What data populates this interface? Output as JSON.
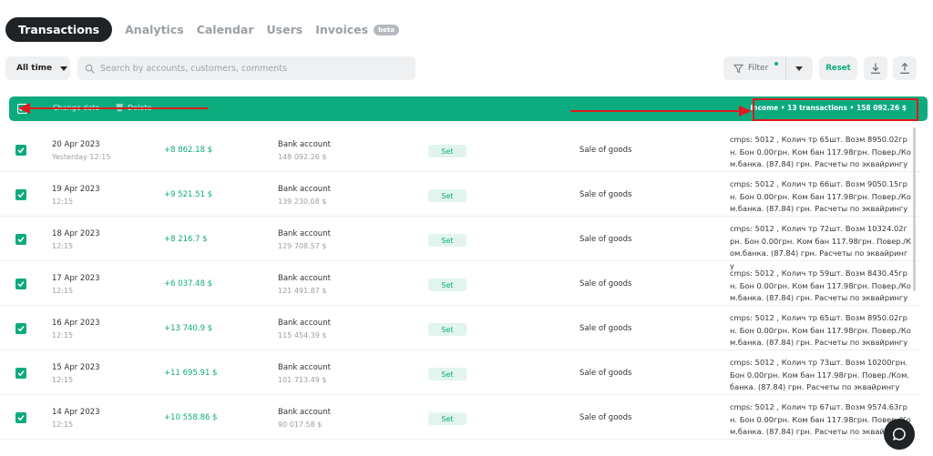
{
  "nav": {
    "tabs": [
      "Transactions",
      "Analytics",
      "Calendar",
      "Users",
      "Invoices"
    ],
    "beta": "beta"
  },
  "toolbar": {
    "period": "All time",
    "search_placeholder": "Search by accounts, customers, comments",
    "filter": "Filter",
    "reset": "Reset"
  },
  "actionbar": {
    "change_date": "Change date",
    "delete": "Delete",
    "income_summary": "Income • 13 transactions • 158 092.26 $"
  },
  "colors": {
    "accent": "#0cab7e",
    "annotation": "#e0191f",
    "dark": "#1f2326"
  },
  "rows": [
    {
      "date": "20 Apr 2023",
      "time": "Yesterday 12:15",
      "amount": "+8 862.18 $",
      "account": "Bank account",
      "balance": "148 092.26 $",
      "set": "Set",
      "category": "Sale of goods",
      "desc": "cmps: 5012 , Колич тр 65шт. Возм 8950.02грн. Бон 0.00грн. Ком бан 117.98грн. Повер./Ком.банка. (87.84) грн. Расчеты по эквайрингу"
    },
    {
      "date": "19 Apr 2023",
      "time": "12:15",
      "amount": "+9 521.51 $",
      "account": "Bank account",
      "balance": "139 230.08 $",
      "set": "Set",
      "category": "Sale of goods",
      "desc": "cmps: 5012 , Колич тр 66шт. Возм 9050.15грн. Бон 0.00грн. Ком бан 117.98грн. Повер./Ком.банка. (87.84) грн. Расчеты по эквайрингу"
    },
    {
      "date": "18 Apr 2023",
      "time": "12:15",
      "amount": "+8 216.7 $",
      "account": "Bank account",
      "balance": "129 708.57 $",
      "set": "Set",
      "category": "Sale of goods",
      "desc": "cmps: 5012 , Колич тр 72шт. Возм 10324.02грн. Бон 0.00грн. Ком бан 117.98грн. Повер./Ком.банка. (87.84) грн. Расчеты по эквайрингу"
    },
    {
      "date": "17 Apr 2023",
      "time": "12:15",
      "amount": "+6 037.48 $",
      "account": "Bank account",
      "balance": "121 491.87 $",
      "set": "Set",
      "category": "Sale of goods",
      "desc": "cmps: 5012 , Колич тр 59шт. Возм 8430.45грн. Бон 0.00грн. Ком бан 117.98грн. Повер./Ком.банка. (87.84) грн. Расчеты по эквайрингу"
    },
    {
      "date": "16 Apr 2023",
      "time": "12:15",
      "amount": "+13 740.9 $",
      "account": "Bank account",
      "balance": "115 454.39 $",
      "set": "Set",
      "category": "Sale of goods",
      "desc": "cmps: 5012 , Колич тр 65шт. Возм 8950.02грн. Бон 0.00грн. Ком бан 117.98грн. Повер./Ком.банка. (87.84) грн. Расчеты по эквайрингу"
    },
    {
      "date": "15 Apr 2023",
      "time": "12:15",
      "amount": "+11 695.91 $",
      "account": "Bank account",
      "balance": "101 713.49 $",
      "set": "Set",
      "category": "Sale of goods",
      "desc": "cmps: 5012 , Колич тр 73шт. Возм 10200грн. Бон 0.00грн. Ком бан 117.98грн. Повер./Ком.банка. (87.84) грн. Расчеты по эквайрингу"
    },
    {
      "date": "14 Apr 2023",
      "time": "12:15",
      "amount": "+10 558.86 $",
      "account": "Bank account",
      "balance": "90 017.58 $",
      "set": "Set",
      "category": "Sale of goods",
      "desc": "cmps: 5012 , Колич тр 67шт. Возм 9574.63грн. Бон 0.00грн. Ком бан 117.98грн. Повер./Ком.банка. (87.84) грн. Расчеты по эквайрингу"
    }
  ]
}
